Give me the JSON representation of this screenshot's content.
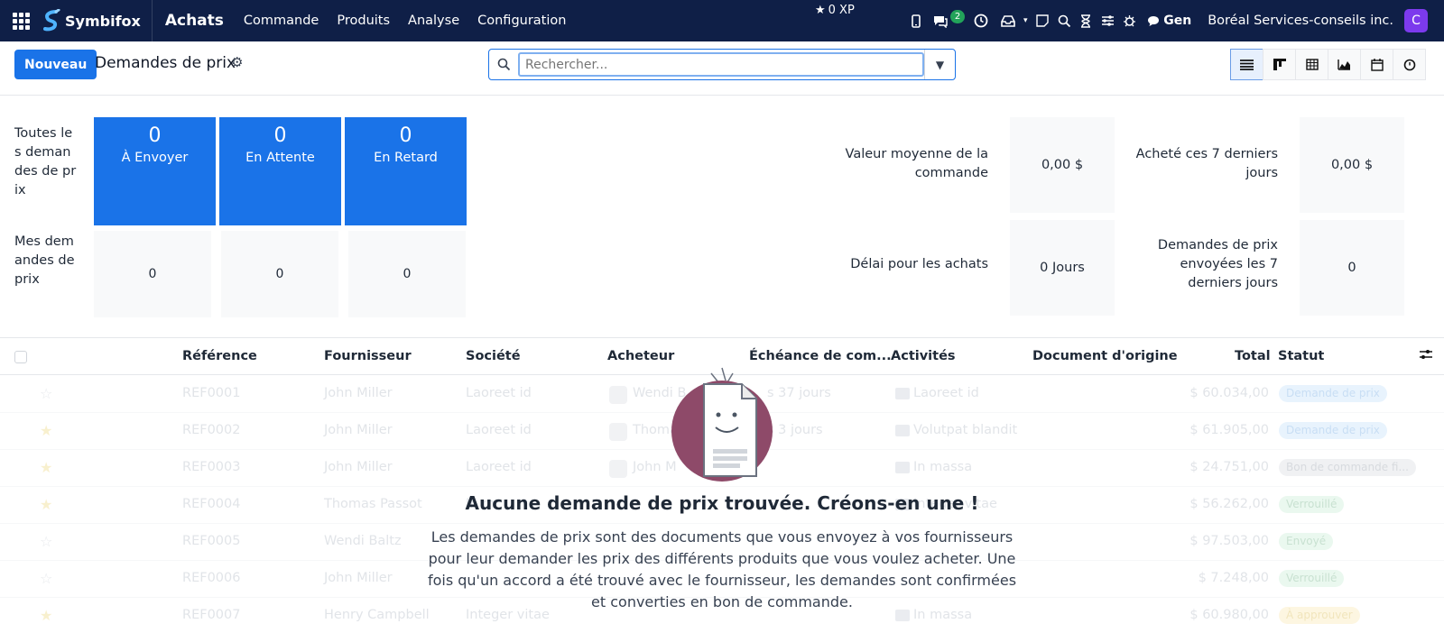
{
  "navbar": {
    "brand": "Symbifox",
    "module": "Achats",
    "menu": [
      "Commande",
      "Produits",
      "Analyse",
      "Configuration"
    ],
    "xp": "0 XP",
    "chat_count": "2",
    "gen": "Gen",
    "company": "Boréal Services-conseils inc.",
    "avatar_letter": "C",
    "colors": {
      "background": "#0f1f47",
      "avatar": "#7c3aed",
      "badge": "#22a35a"
    }
  },
  "control": {
    "new_label": "Nouveau",
    "title": "Demandes de prix",
    "search_placeholder": "Rechercher...",
    "accent": "#1a73e8"
  },
  "dashboard": {
    "row_all": "Toutes les demandes de prix",
    "row_mine": "Mes demandes de prix",
    "tiles": [
      {
        "value": "0",
        "label": "À Envoyer"
      },
      {
        "value": "0",
        "label": "En Attente"
      },
      {
        "value": "0",
        "label": "En Retard"
      }
    ],
    "mine_values": [
      "0",
      "0",
      "0"
    ],
    "stats": [
      {
        "label": "Valeur moyenne de la commande",
        "value": "0,00 $"
      },
      {
        "label": "Acheté ces 7 derniers jours",
        "value": "0,00 $"
      },
      {
        "label": "Délai pour les achats",
        "value": "0 Jours"
      },
      {
        "label": "Demandes de prix envoyées les 7 derniers jours",
        "value": "0"
      }
    ]
  },
  "table": {
    "headers": {
      "reference": "Référence",
      "supplier": "Fournisseur",
      "company": "Société",
      "buyer": "Acheteur",
      "deadline": "Échéance de com...",
      "activities": "Activités",
      "origin": "Document d'origine",
      "total": "Total",
      "status": "Statut"
    },
    "rows": [
      {
        "ref": "REF0001",
        "supplier": "John Miller",
        "company": "Laoreet id",
        "buyer": "Wendi B",
        "deadline": "s 37 jours",
        "activity": "Laoreet id",
        "total": "$ 60.034,00",
        "status": "Demande de prix",
        "starred": false
      },
      {
        "ref": "REF0002",
        "supplier": "John Miller",
        "company": "Laoreet id",
        "buyer": "Thoma",
        "deadline": "s 3 jours",
        "activity": "Volutpat blandit",
        "total": "$ 61.905,00",
        "status": "Demande de prix",
        "starred": true
      },
      {
        "ref": "REF0003",
        "supplier": "John Miller",
        "company": "Laoreet id",
        "buyer": "John M",
        "deadline": "",
        "activity": "In massa",
        "total": "$ 24.751,00",
        "status": "Bon de commande fi...",
        "starred": true
      },
      {
        "ref": "REF0004",
        "supplier": "Thomas Passot",
        "company": "In m",
        "buyer": "",
        "deadline": "",
        "activity": "Integer vitae",
        "total": "$ 56.262,00",
        "status": "Verrouillé",
        "starred": true
      },
      {
        "ref": "REF0005",
        "supplier": "Wendi Baltz",
        "company": "",
        "buyer": "",
        "deadline": "",
        "activity": "",
        "total": "$ 97.503,00",
        "status": "Envoyé",
        "starred": false
      },
      {
        "ref": "REF0006",
        "supplier": "John Miller",
        "company": "",
        "buyer": "",
        "deadline": "",
        "activity": "",
        "total": "$ 7.248,00",
        "status": "Verrouillé",
        "starred": false
      },
      {
        "ref": "REF0007",
        "supplier": "Henry Campbell",
        "company": "Integer vitae",
        "buyer": "",
        "deadline": "",
        "activity": "In massa",
        "total": "$ 60.980,00",
        "status": "À approuver",
        "starred": true
      }
    ]
  },
  "helper": {
    "title": "Aucune demande de prix trouvée. Créons-en une !",
    "text": "Les demandes de prix sont des documents que vous envoyez à vos fournisseurs pour leur demander les prix des différents produits que vous voulez acheter. Une fois qu'un accord a été trouvé avec le fournisseur, les demandes sont confirmées et converties en bon de commande."
  }
}
